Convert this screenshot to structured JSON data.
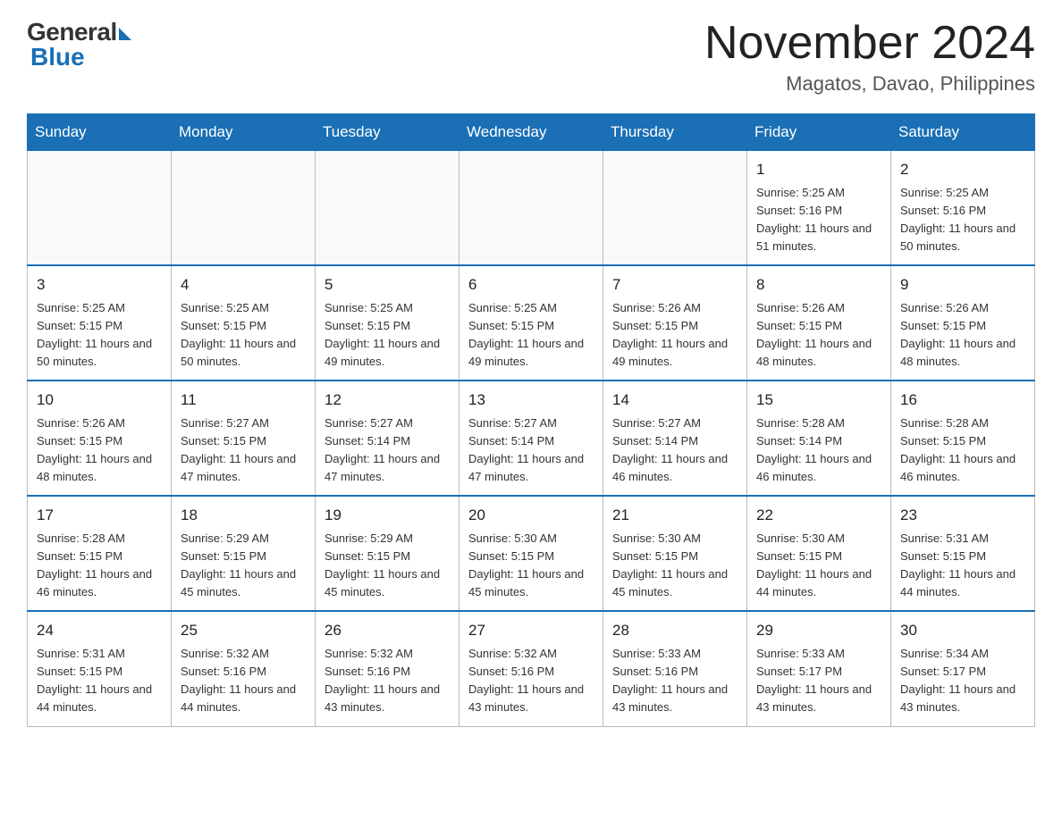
{
  "header": {
    "logo": {
      "general": "General",
      "blue": "Blue"
    },
    "title": "November 2024",
    "location": "Magatos, Davao, Philippines"
  },
  "days_of_week": [
    "Sunday",
    "Monday",
    "Tuesday",
    "Wednesday",
    "Thursday",
    "Friday",
    "Saturday"
  ],
  "weeks": [
    [
      {
        "day": "",
        "info": ""
      },
      {
        "day": "",
        "info": ""
      },
      {
        "day": "",
        "info": ""
      },
      {
        "day": "",
        "info": ""
      },
      {
        "day": "",
        "info": ""
      },
      {
        "day": "1",
        "info": "Sunrise: 5:25 AM\nSunset: 5:16 PM\nDaylight: 11 hours\nand 51 minutes."
      },
      {
        "day": "2",
        "info": "Sunrise: 5:25 AM\nSunset: 5:16 PM\nDaylight: 11 hours\nand 50 minutes."
      }
    ],
    [
      {
        "day": "3",
        "info": "Sunrise: 5:25 AM\nSunset: 5:15 PM\nDaylight: 11 hours\nand 50 minutes."
      },
      {
        "day": "4",
        "info": "Sunrise: 5:25 AM\nSunset: 5:15 PM\nDaylight: 11 hours\nand 50 minutes."
      },
      {
        "day": "5",
        "info": "Sunrise: 5:25 AM\nSunset: 5:15 PM\nDaylight: 11 hours\nand 49 minutes."
      },
      {
        "day": "6",
        "info": "Sunrise: 5:25 AM\nSunset: 5:15 PM\nDaylight: 11 hours\nand 49 minutes."
      },
      {
        "day": "7",
        "info": "Sunrise: 5:26 AM\nSunset: 5:15 PM\nDaylight: 11 hours\nand 49 minutes."
      },
      {
        "day": "8",
        "info": "Sunrise: 5:26 AM\nSunset: 5:15 PM\nDaylight: 11 hours\nand 48 minutes."
      },
      {
        "day": "9",
        "info": "Sunrise: 5:26 AM\nSunset: 5:15 PM\nDaylight: 11 hours\nand 48 minutes."
      }
    ],
    [
      {
        "day": "10",
        "info": "Sunrise: 5:26 AM\nSunset: 5:15 PM\nDaylight: 11 hours\nand 48 minutes."
      },
      {
        "day": "11",
        "info": "Sunrise: 5:27 AM\nSunset: 5:15 PM\nDaylight: 11 hours\nand 47 minutes."
      },
      {
        "day": "12",
        "info": "Sunrise: 5:27 AM\nSunset: 5:14 PM\nDaylight: 11 hours\nand 47 minutes."
      },
      {
        "day": "13",
        "info": "Sunrise: 5:27 AM\nSunset: 5:14 PM\nDaylight: 11 hours\nand 47 minutes."
      },
      {
        "day": "14",
        "info": "Sunrise: 5:27 AM\nSunset: 5:14 PM\nDaylight: 11 hours\nand 46 minutes."
      },
      {
        "day": "15",
        "info": "Sunrise: 5:28 AM\nSunset: 5:14 PM\nDaylight: 11 hours\nand 46 minutes."
      },
      {
        "day": "16",
        "info": "Sunrise: 5:28 AM\nSunset: 5:15 PM\nDaylight: 11 hours\nand 46 minutes."
      }
    ],
    [
      {
        "day": "17",
        "info": "Sunrise: 5:28 AM\nSunset: 5:15 PM\nDaylight: 11 hours\nand 46 minutes."
      },
      {
        "day": "18",
        "info": "Sunrise: 5:29 AM\nSunset: 5:15 PM\nDaylight: 11 hours\nand 45 minutes."
      },
      {
        "day": "19",
        "info": "Sunrise: 5:29 AM\nSunset: 5:15 PM\nDaylight: 11 hours\nand 45 minutes."
      },
      {
        "day": "20",
        "info": "Sunrise: 5:30 AM\nSunset: 5:15 PM\nDaylight: 11 hours\nand 45 minutes."
      },
      {
        "day": "21",
        "info": "Sunrise: 5:30 AM\nSunset: 5:15 PM\nDaylight: 11 hours\nand 45 minutes."
      },
      {
        "day": "22",
        "info": "Sunrise: 5:30 AM\nSunset: 5:15 PM\nDaylight: 11 hours\nand 44 minutes."
      },
      {
        "day": "23",
        "info": "Sunrise: 5:31 AM\nSunset: 5:15 PM\nDaylight: 11 hours\nand 44 minutes."
      }
    ],
    [
      {
        "day": "24",
        "info": "Sunrise: 5:31 AM\nSunset: 5:15 PM\nDaylight: 11 hours\nand 44 minutes."
      },
      {
        "day": "25",
        "info": "Sunrise: 5:32 AM\nSunset: 5:16 PM\nDaylight: 11 hours\nand 44 minutes."
      },
      {
        "day": "26",
        "info": "Sunrise: 5:32 AM\nSunset: 5:16 PM\nDaylight: 11 hours\nand 43 minutes."
      },
      {
        "day": "27",
        "info": "Sunrise: 5:32 AM\nSunset: 5:16 PM\nDaylight: 11 hours\nand 43 minutes."
      },
      {
        "day": "28",
        "info": "Sunrise: 5:33 AM\nSunset: 5:16 PM\nDaylight: 11 hours\nand 43 minutes."
      },
      {
        "day": "29",
        "info": "Sunrise: 5:33 AM\nSunset: 5:17 PM\nDaylight: 11 hours\nand 43 minutes."
      },
      {
        "day": "30",
        "info": "Sunrise: 5:34 AM\nSunset: 5:17 PM\nDaylight: 11 hours\nand 43 minutes."
      }
    ]
  ]
}
